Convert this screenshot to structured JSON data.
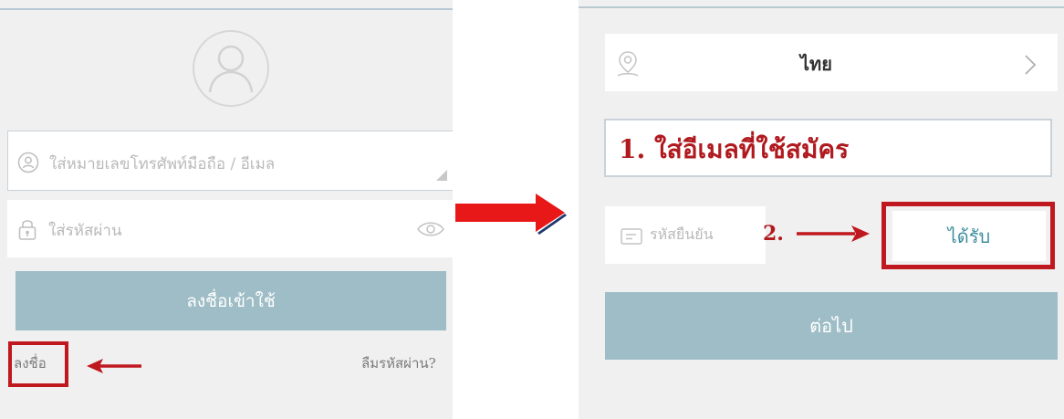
{
  "login": {
    "phone_email_placeholder": "ใส่หมายเลขโทรศัพท์มือถือ / อีเมล",
    "password_placeholder": "ใส่รหัสผ่าน",
    "login_button": "ลงชื่อเข้าใช้",
    "register_link": "ลงชื่อ",
    "forgot_link": "ลืมรหัสผ่าน?"
  },
  "register": {
    "country": "ไทย",
    "email_annotation": "1. ใส่อีเมลที่ใช้สมัคร",
    "code_placeholder": "รหัสยืนยัน",
    "step2_annotation": "2.",
    "get_code_button": "ได้รับ",
    "next_button": "ต่อไป"
  },
  "colors": {
    "accent_button": "#9ebdc6",
    "annotation_red": "#c0181f",
    "link_teal": "#3e8ea0"
  },
  "icons": [
    "avatar-icon",
    "user-circle-icon",
    "lock-icon",
    "eye-icon",
    "location-pin-icon",
    "chevron-right-icon",
    "code-card-icon",
    "arrow-right-icon",
    "arrow-left-icon"
  ]
}
